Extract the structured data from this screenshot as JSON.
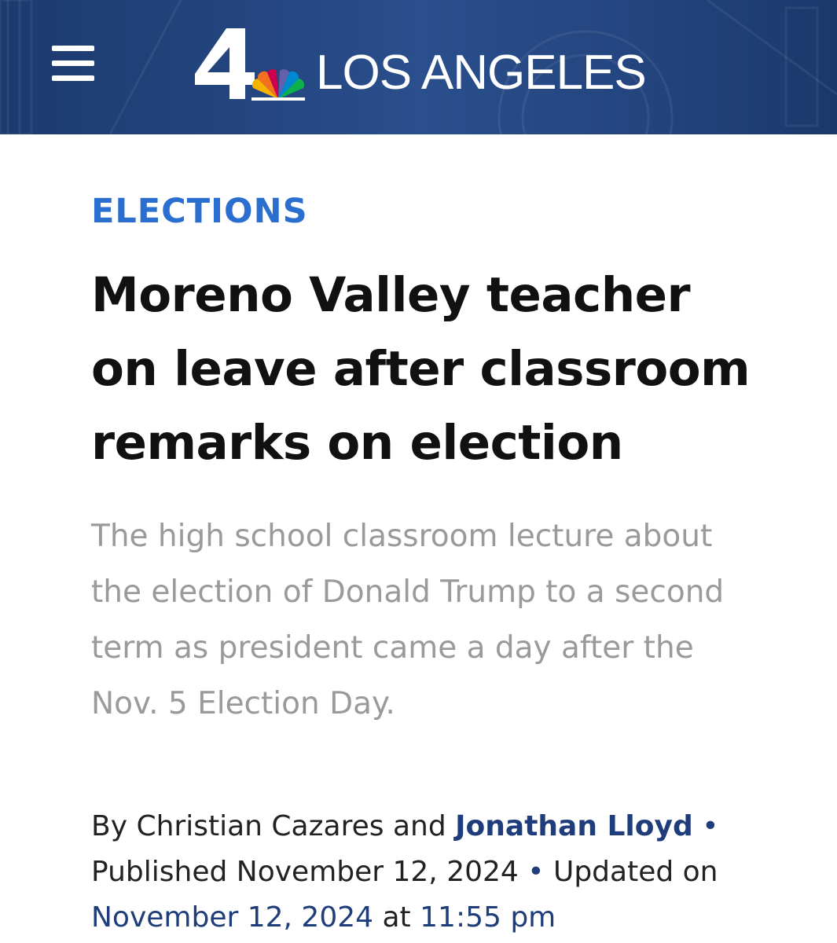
{
  "header": {
    "logo_number": "4",
    "logo_text": "LOS ANGELES",
    "colors": {
      "background": "#24457f",
      "text": "#ffffff"
    },
    "icons": {
      "menu": "hamburger-menu-icon",
      "peacock": "nbc-peacock-icon"
    }
  },
  "article": {
    "category": "ELECTIONS",
    "headline": "Moreno Valley teacher on leave after classroom remarks on election",
    "subheadline": "The high school classroom lecture about the election of Donald Trump to a second term as president came a day after the Nov. 5 Election Day.",
    "byline": {
      "prefix": "By",
      "author1": "Christian Cazares",
      "conjunction": "and",
      "author2": "Jonathan Lloyd",
      "separator": "•",
      "published_label": "Published",
      "published_date": "November 12, 2024",
      "updated_label": "Updated on",
      "updated_date": "November 12, 2024",
      "at_label": "at",
      "updated_time": "11:55 pm"
    },
    "colors": {
      "category": "#2a6fd0",
      "headline": "#111111",
      "subheadline": "#9a9a9a",
      "link": "#1e3d7a"
    }
  }
}
